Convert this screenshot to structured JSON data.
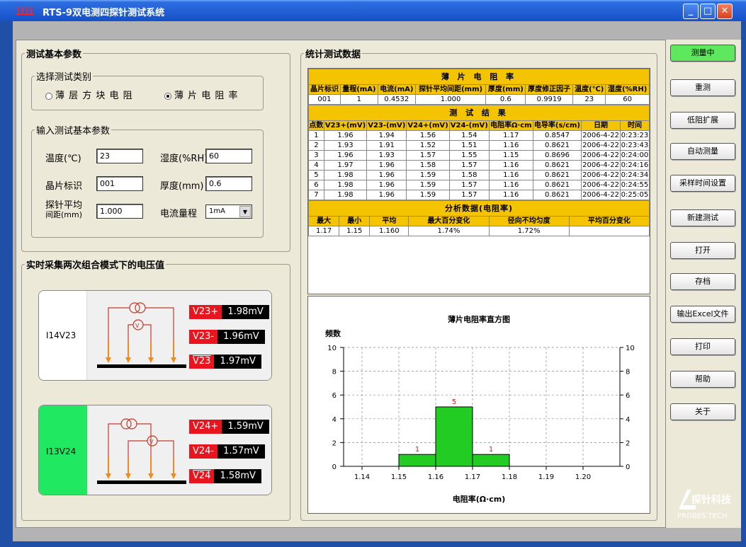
{
  "window": {
    "title": "RTS-9双电测四探针测试系统",
    "min": "_",
    "max": "□",
    "close": "✕"
  },
  "basic": {
    "legend": "测试基本参数",
    "category_legend": "选择测试类别",
    "opt1": "薄 层 方 块 电 阻",
    "opt2": "薄 片 电 阻 率",
    "input_legend": "输入测试基本参数",
    "temp_label": "温度(℃)",
    "temp_value": "23",
    "humid_label": "湿度(%RH)",
    "humid_value": "60",
    "wafer_label": "晶片标识",
    "wafer_value": "001",
    "thick_label": "厚度(mm)",
    "thick_value": "0.6",
    "probe_label1": "探针平均",
    "probe_label2": "间距(mm)",
    "probe_value": "1.000",
    "range_label": "电流量程",
    "range_value": "1mA"
  },
  "realtime": {
    "legend": "实时采集两次组合模式下的电压值",
    "p1": {
      "label": "I14V23",
      "tags": [
        {
          "n": "V23+",
          "v": "1.98mV"
        },
        {
          "n": "V23-",
          "v": "1.96mV"
        },
        {
          "n": "V23",
          "v": "1.97mV"
        }
      ]
    },
    "p2": {
      "label": "I13V24",
      "tags": [
        {
          "n": "V24+",
          "v": "1.59mV"
        },
        {
          "n": "V24-",
          "v": "1.57mV"
        },
        {
          "n": "V24",
          "v": "1.58mV"
        }
      ]
    }
  },
  "stats": {
    "legend": "统计测试数据",
    "title": "薄 片 电 阻 率",
    "hdr1": [
      "晶片标识",
      "量程(mA)",
      "电流(mA)",
      "探针平均间距(mm)",
      "厚度(mm)",
      "厚度修正因子",
      "温度(℃)",
      "湿度(%RH)"
    ],
    "row1": [
      "001",
      "1",
      "0.4532",
      "1.000",
      "0.6",
      "0.9919",
      "23",
      "60"
    ],
    "result_title": "测 试 结 果",
    "hdr2": [
      "点数",
      "V23+(mV)",
      "V23-(mV)",
      "V24+(mV)",
      "V24-(mV)",
      "电阻率Ω·cm",
      "电导率(s/cm)",
      "日期",
      "时间"
    ],
    "rows": [
      [
        "1",
        "1.96",
        "1.94",
        "1.56",
        "1.54",
        "1.17",
        "0.8547",
        "2006-4-22",
        "0:23:23"
      ],
      [
        "2",
        "1.93",
        "1.91",
        "1.52",
        "1.51",
        "1.16",
        "0.8621",
        "2006-4-22",
        "0:23:43"
      ],
      [
        "3",
        "1.96",
        "1.93",
        "1.57",
        "1.55",
        "1.15",
        "0.8696",
        "2006-4-22",
        "0:24:00"
      ],
      [
        "4",
        "1.97",
        "1.96",
        "1.58",
        "1.57",
        "1.16",
        "0.8621",
        "2006-4-22",
        "0:24:16"
      ],
      [
        "5",
        "1.98",
        "1.96",
        "1.59",
        "1.58",
        "1.16",
        "0.8621",
        "2006-4-22",
        "0:24:34"
      ],
      [
        "6",
        "1.98",
        "1.96",
        "1.59",
        "1.57",
        "1.16",
        "0.8621",
        "2006-4-22",
        "0:24:55"
      ],
      [
        "7",
        "1.98",
        "1.96",
        "1.59",
        "1.57",
        "1.16",
        "0.8621",
        "2006-4-22",
        "0:25:05"
      ]
    ],
    "analysis_title": "分析数据(电阻率)",
    "hdr3": [
      "最大",
      "最小",
      "平均",
      "最大百分变化",
      "径向不均匀度",
      "平均百分变化"
    ],
    "row3": [
      "1.17",
      "1.15",
      "1.160",
      "1.74%",
      "1.72%",
      ""
    ]
  },
  "chart_data": {
    "type": "bar",
    "title": "薄片电阻率直方图",
    "ylabel": "频数",
    "xlabel": "电阻率(Ω·cm)",
    "x_ticks": [
      "1.14",
      "1.15",
      "1.16",
      "1.17",
      "1.18",
      "1.19",
      "1.20"
    ],
    "y_ticks": [
      "0",
      "2",
      "4",
      "6",
      "8",
      "10"
    ],
    "bins": [
      [
        1.15,
        1.16
      ],
      [
        1.16,
        1.17
      ],
      [
        1.17,
        1.18
      ]
    ],
    "values": [
      1,
      5,
      1
    ],
    "ylim": [
      0,
      10
    ],
    "xlim": [
      1.135,
      1.21
    ],
    "grid": true,
    "bar_color": "#22cc22"
  },
  "buttons": [
    "测量中",
    "重测",
    "低阻扩展",
    "自动测量",
    "采样时间设置",
    "新建测试",
    "打开",
    "存档",
    "输出Excel文件",
    "打印",
    "帮助",
    "关于"
  ],
  "brand": {
    "cn": "探针科技",
    "en": "PROBES TECH"
  }
}
